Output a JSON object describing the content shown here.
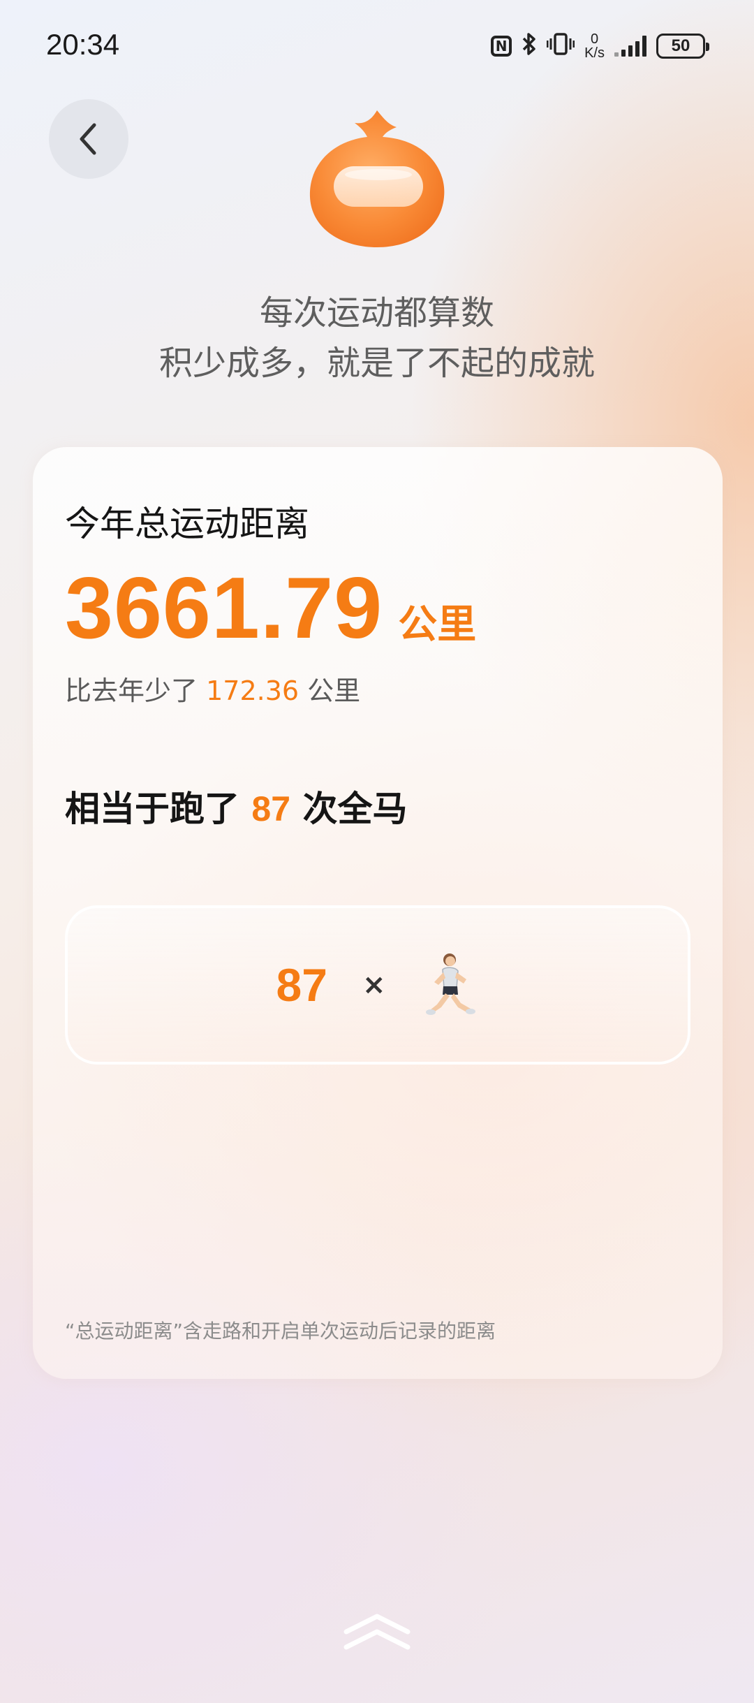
{
  "status_bar": {
    "time": "20:34",
    "net_speed_value": "0",
    "net_speed_unit": "K/s",
    "battery": "50",
    "icons": [
      "nfc-icon",
      "bluetooth-icon",
      "vibrate-icon",
      "signal-icon",
      "battery-icon"
    ]
  },
  "header": {
    "back_icon": "chevron-left-icon",
    "mascot_icon": "orange-mascot-icon",
    "slogan_line1": "每次运动都算数",
    "slogan_line2": "积少成多，就是了不起的成就"
  },
  "card": {
    "title": "今年总运动距离",
    "distance_value": "3661.79",
    "distance_unit": "公里",
    "compare_prefix": "比去年少了 ",
    "compare_value": "172.36",
    "compare_suffix": " 公里",
    "equiv_prefix": "相当于跑了 ",
    "equiv_value": "87",
    "equiv_suffix": " 次全马",
    "runner_count": "87",
    "times_sign": "×",
    "runner_icon": "runner-icon",
    "footnote": "“总运动距离”含走路和开启单次运动后记录的距离"
  },
  "footer": {
    "swipe_icon": "double-chevron-up-icon"
  },
  "colors": {
    "accent": "#f57c14",
    "text_primary": "#151515",
    "text_secondary": "#5a5a5a",
    "text_hint": "#8c8c8c"
  }
}
